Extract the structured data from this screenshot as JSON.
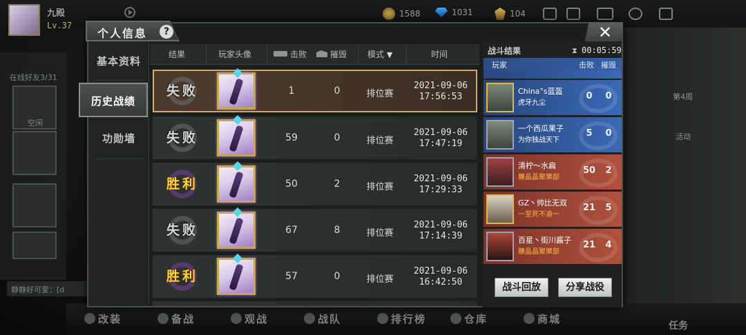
{
  "hud": {
    "player_name": "九殿",
    "player_level": "Lv.37",
    "coins": "1588",
    "diamonds": "1031",
    "medals": "104"
  },
  "side_left": {
    "friends_online": "在线好友3/31",
    "name_label": "空闲"
  },
  "side_right": {
    "week_label": "第4周",
    "event_label": "活动"
  },
  "chat": {
    "text": "静静好可爱：[d"
  },
  "bottom_nav": {
    "items": [
      "改装",
      "备战",
      "观战",
      "战队",
      "排行榜",
      "仓库",
      "商城"
    ],
    "task": "任务"
  },
  "dialog": {
    "title": "个人信息",
    "help": "?",
    "nav": [
      {
        "label": "基本资料"
      },
      {
        "label": "历史战绩",
        "active": true
      },
      {
        "label": "功勋墙"
      }
    ],
    "columns": {
      "result": "结果",
      "avatar": "玩家头像",
      "kills": "击败",
      "destroy": "摧毁",
      "mode": "模式",
      "time": "时间"
    },
    "rows": [
      {
        "result": "失败",
        "win": false,
        "kills": "1",
        "destroy": "0",
        "mode": "排位赛",
        "date": "2021-09-06",
        "time": "17:56:53",
        "selected": true
      },
      {
        "result": "失败",
        "win": false,
        "kills": "59",
        "destroy": "0",
        "mode": "排位赛",
        "date": "2021-09-06",
        "time": "17:47:19"
      },
      {
        "result": "胜利",
        "win": true,
        "kills": "50",
        "destroy": "2",
        "mode": "排位赛",
        "date": "2021-09-06",
        "time": "17:29:33"
      },
      {
        "result": "失败",
        "win": false,
        "kills": "67",
        "destroy": "8",
        "mode": "排位赛",
        "date": "2021-09-06",
        "time": "17:14:39"
      },
      {
        "result": "胜利",
        "win": true,
        "kills": "57",
        "destroy": "0",
        "mode": "排位赛",
        "date": "2021-09-06",
        "time": "16:42:50"
      }
    ]
  },
  "battle": {
    "title": "战斗结果",
    "timer": "00:05:59",
    "col_player": "玩家",
    "col_kills": "击败",
    "col_destroy": "摧毁",
    "players": [
      {
        "name": "China°s蓝盔",
        "tag": "虎牙九尘",
        "kills": "0",
        "destroy": "0",
        "team": "blue",
        "gold": true
      },
      {
        "name": "一个西瓜果子",
        "tag": "为你独战天下",
        "kills": "5",
        "destroy": "0",
        "team": "blue"
      },
      {
        "name": "清柠～水扁",
        "tag": "髏晶晶聚樂部",
        "kills": "50",
        "destroy": "2",
        "team": "red"
      },
      {
        "name": "GZ丶帅比无双",
        "tag": "一至死不渝一",
        "kills": "21",
        "destroy": "5",
        "team": "red",
        "gold": true
      },
      {
        "name": "百星丶街川酱子",
        "tag": "髏晶晶聚樂部",
        "kills": "21",
        "destroy": "4",
        "team": "red"
      }
    ],
    "replay_btn": "战斗回放",
    "share_btn": "分享战役"
  }
}
